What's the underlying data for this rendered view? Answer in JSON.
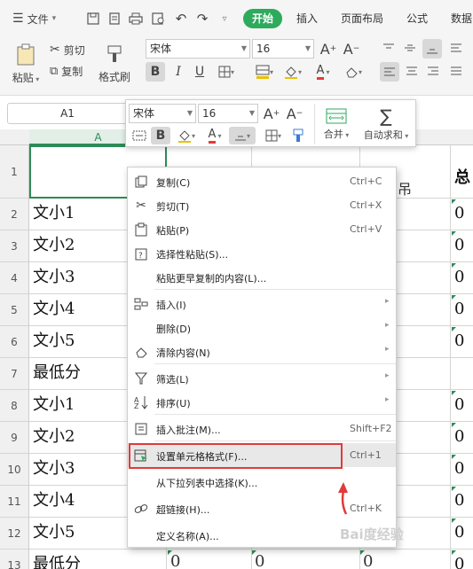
{
  "ribbon": {
    "file_label": "文件",
    "tabs": [
      "开始",
      "插入",
      "页面布局",
      "公式",
      "数据"
    ],
    "paste_label": "粘贴",
    "cut_label": "剪切",
    "copy_label": "复制",
    "format_painter_label": "格式刷",
    "font_name": "宋体",
    "font_size": "16",
    "bold_label": "B",
    "italic_label": "I",
    "underline_label": "U"
  },
  "namebox": {
    "value": "A1"
  },
  "mini_toolbar": {
    "font_name": "宋体",
    "font_size": "16",
    "merge_label": "合并",
    "autosum_label": "自动求和"
  },
  "grid": {
    "col_a_header": "A",
    "rows": [
      {
        "num": "1",
        "a": "",
        "right": "总"
      },
      {
        "num": "2",
        "a": "文小1",
        "right": "0"
      },
      {
        "num": "3",
        "a": "文小2",
        "right": "0"
      },
      {
        "num": "4",
        "a": "文小3",
        "right": "0"
      },
      {
        "num": "5",
        "a": "文小4",
        "right": "0"
      },
      {
        "num": "6",
        "a": "文小5",
        "right": "0"
      },
      {
        "num": "7",
        "a": "最低分",
        "right": ""
      },
      {
        "num": "8",
        "a": "文小1",
        "right": "0"
      },
      {
        "num": "9",
        "a": "文小2",
        "right": "0"
      },
      {
        "num": "10",
        "a": "文小3",
        "right": "0"
      },
      {
        "num": "11",
        "a": "文小4",
        "right": "0"
      },
      {
        "num": "12",
        "a": "文小5",
        "right": "0"
      },
      {
        "num": "13",
        "a": "最低分",
        "right": "0"
      }
    ],
    "row1_partial": "吊",
    "row13_b": "0",
    "row13_c": "0",
    "row13_d": "0"
  },
  "context_menu": {
    "items": [
      {
        "label": "复制(C)",
        "shortcut": "Ctrl+C",
        "icon": "copy-icon"
      },
      {
        "label": "剪切(T)",
        "shortcut": "Ctrl+X",
        "icon": "scissors-icon"
      },
      {
        "label": "粘贴(P)",
        "shortcut": "Ctrl+V",
        "icon": "paste-icon"
      },
      {
        "label": "选择性粘贴(S)...",
        "shortcut": "",
        "icon": "paste-special-icon"
      },
      {
        "label": "粘贴更早复制的内容(L)...",
        "shortcut": "",
        "icon": ""
      },
      {
        "label": "插入(I)",
        "shortcut": "",
        "icon": "insert-icon"
      },
      {
        "label": "删除(D)",
        "shortcut": "",
        "icon": ""
      },
      {
        "label": "清除内容(N)",
        "shortcut": "",
        "icon": "eraser-icon"
      },
      {
        "label": "筛选(L)",
        "shortcut": "",
        "icon": "filter-icon"
      },
      {
        "label": "排序(U)",
        "shortcut": "",
        "icon": "sort-icon"
      },
      {
        "label": "插入批注(M)...",
        "shortcut": "Shift+F2",
        "icon": "comment-icon"
      },
      {
        "label": "设置单元格格式(F)...",
        "shortcut": "Ctrl+1",
        "icon": "format-cells-icon"
      },
      {
        "label": "从下拉列表中选择(K)...",
        "shortcut": "",
        "icon": ""
      },
      {
        "label": "超链接(H)...",
        "shortcut": "Ctrl+K",
        "icon": "link-icon"
      },
      {
        "label": "定义名称(A)...",
        "shortcut": "",
        "icon": ""
      }
    ]
  },
  "watermark": "Bai度经验",
  "colors": {
    "accent": "#2eaa5c",
    "highlight_box": "#e03a3a",
    "selection": "#2e8b57"
  }
}
